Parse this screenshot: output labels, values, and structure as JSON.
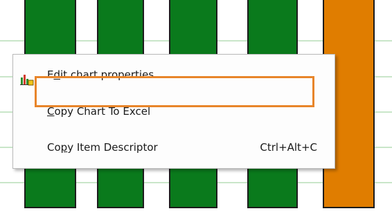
{
  "chart_data": {
    "type": "bar",
    "categories": [
      "",
      "",
      "",
      "",
      ""
    ],
    "series": [
      {
        "values": [
          1,
          1,
          1,
          1,
          1
        ],
        "colors": [
          "#0a7a1c",
          "#0a7a1c",
          "#0a7a1c",
          "#0a7a1c",
          "#e07d00"
        ]
      }
    ],
    "grid": true,
    "gridline_color": "#c9e6c9"
  },
  "context_menu": {
    "items": [
      {
        "label": "Edit chart properties",
        "underline_index": 1,
        "shortcut": "",
        "icon": "chart-properties-icon"
      },
      {
        "label": "Copy Chart To Excel",
        "underline_index": 0,
        "shortcut": "",
        "icon": ""
      },
      {
        "label": "Copy Item Descriptor",
        "underline_index": 2,
        "shortcut": "Ctrl+Alt+C",
        "icon": "",
        "highlighted": true
      }
    ],
    "highlight_color": "#e8852a"
  },
  "colors": {
    "bar_green": "#0a7a1c",
    "bar_orange": "#e07d00",
    "bar_border": "#1c1c1c"
  }
}
